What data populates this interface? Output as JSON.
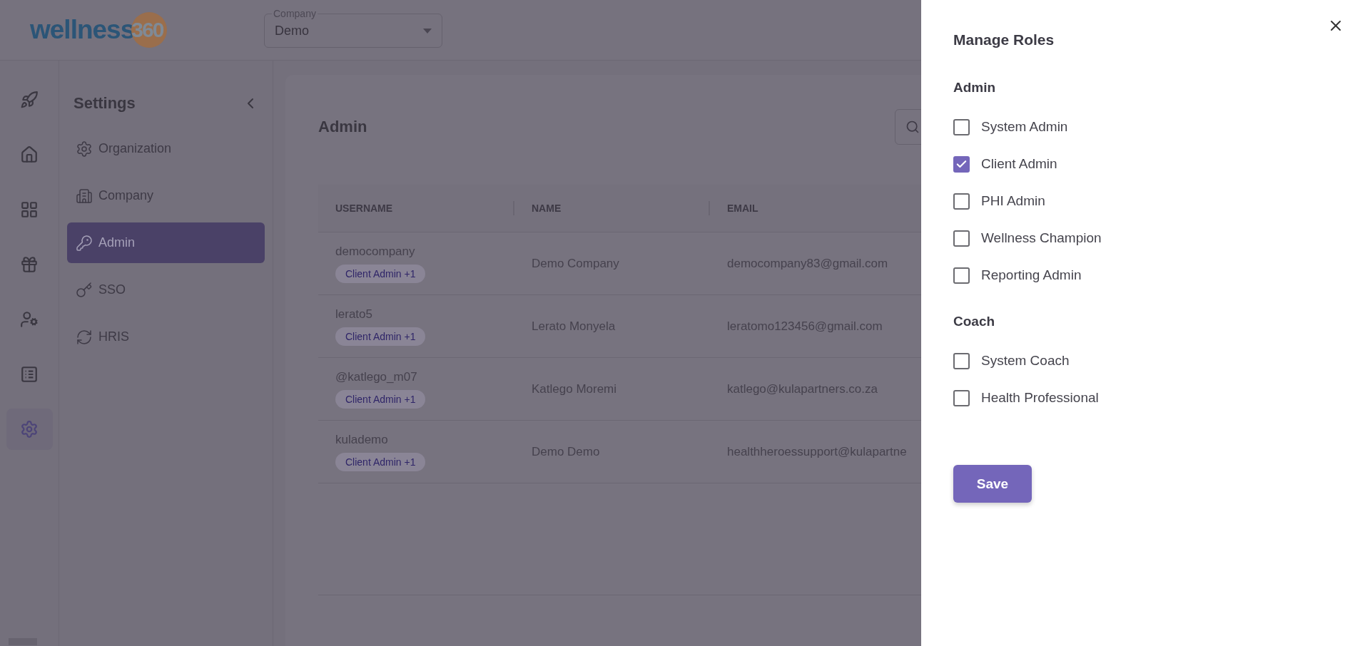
{
  "header": {
    "logo": {
      "word": "wellness",
      "number": "360"
    },
    "company_select": {
      "label": "Company",
      "value": "Demo"
    }
  },
  "icon_rail": [
    {
      "selected": false
    },
    {
      "selected": false
    },
    {
      "selected": false
    },
    {
      "selected": false
    },
    {
      "selected": false
    },
    {
      "selected": false
    },
    {
      "selected": true
    }
  ],
  "settings": {
    "title": "Settings",
    "items": [
      {
        "label": "Organization",
        "selected": false
      },
      {
        "label": "Company",
        "selected": false
      },
      {
        "label": "Admin",
        "selected": true
      },
      {
        "label": "SSO",
        "selected": false
      },
      {
        "label": "HRIS",
        "selected": false
      }
    ]
  },
  "main": {
    "title": "Admin",
    "table": {
      "columns": [
        "USERNAME",
        "NAME",
        "EMAIL"
      ],
      "rows": [
        {
          "username": "democompany",
          "roles": "Client Admin +1",
          "name": "Demo Company",
          "email": "democompany83@gmail.com"
        },
        {
          "username": "lerato5",
          "roles": "Client Admin +1",
          "name": "Lerato Monyela",
          "email": "leratomo123456@gmail.com"
        },
        {
          "username": "@katlego_m07",
          "roles": "Client Admin +1",
          "name": "Katlego Moremi",
          "email": "katlego@kulapartners.co.za"
        },
        {
          "username": "kulademo",
          "roles": "Client Admin +1",
          "name": "Demo Demo",
          "email": "healthheroessupport@kulapartne"
        }
      ]
    }
  },
  "drawer": {
    "title": "Manage Roles",
    "groups": [
      {
        "title": "Admin",
        "roles": [
          {
            "label": "System Admin",
            "checked": false
          },
          {
            "label": "Client Admin",
            "checked": true
          },
          {
            "label": "PHI Admin",
            "checked": false
          },
          {
            "label": "Wellness Champion",
            "checked": false
          },
          {
            "label": "Reporting Admin",
            "checked": false
          }
        ]
      },
      {
        "title": "Coach",
        "roles": [
          {
            "label": "System Coach",
            "checked": false
          },
          {
            "label": "Health Professional",
            "checked": false
          }
        ]
      }
    ],
    "save": "Save"
  }
}
